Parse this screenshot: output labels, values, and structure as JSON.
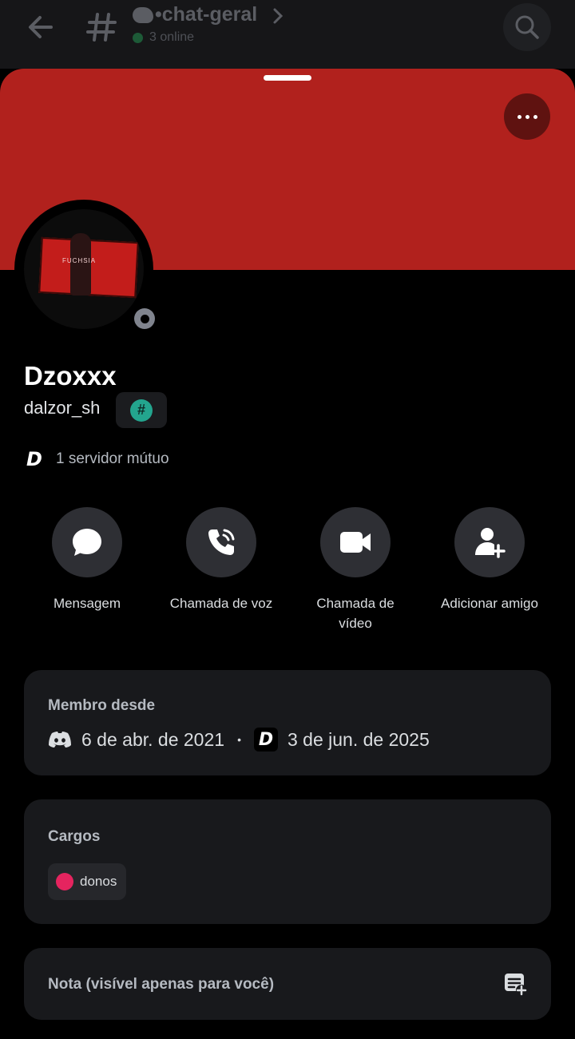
{
  "header": {
    "channel_name": "•chat-geral",
    "online_text": "3 online"
  },
  "profile": {
    "display_name": "Dzoxxx",
    "username": "dalzor_sh",
    "tag_symbol": "#",
    "server_logo": "D",
    "mutual_servers": "1 servidor mútuo",
    "avatar_text": "FUCHSIA",
    "banner_color": "#b1211d",
    "status": "offline"
  },
  "actions": [
    {
      "label": "Mensagem",
      "icon": "message-icon"
    },
    {
      "label": "Chamada de voz",
      "icon": "phone-icon"
    },
    {
      "label": "Chamada de vídeo",
      "icon": "video-icon"
    },
    {
      "label": "Adicionar amigo",
      "icon": "add-friend-icon"
    }
  ],
  "member_since": {
    "title": "Membro desde",
    "discord_date": "6 de abr. de 2021",
    "separator": "•",
    "server_logo": "D",
    "server_date": "3 de jun. de 2025"
  },
  "roles": {
    "title": "Cargos",
    "items": [
      {
        "name": "donos",
        "color": "#e5245f"
      }
    ]
  },
  "note": {
    "title": "Nota (visível apenas para você)"
  }
}
